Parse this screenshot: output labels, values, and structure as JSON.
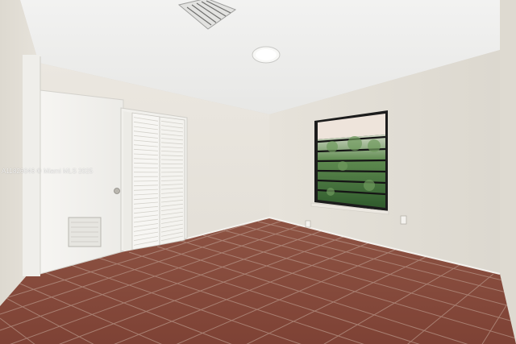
{
  "watermark": {
    "text": "A11826046 © Miami MLS 2025"
  },
  "scene": {
    "description_icons": [
      "ceiling-vent-icon",
      "ceiling-light-icon",
      "door-vent-icon",
      "door-knob-icon",
      "wall-outlet-icon"
    ],
    "colors": {
      "ceiling": "#eeeeec",
      "wall_left": "#e6e2da",
      "wall_back": "#e9e5de",
      "wall_right": "#e3dfd7",
      "floor_tile": "#8a4a3c",
      "grout": "#b89588",
      "door": "#f4f3f0",
      "window_frame": "#1c1c1c",
      "window_view": "#3f6b3a"
    }
  }
}
